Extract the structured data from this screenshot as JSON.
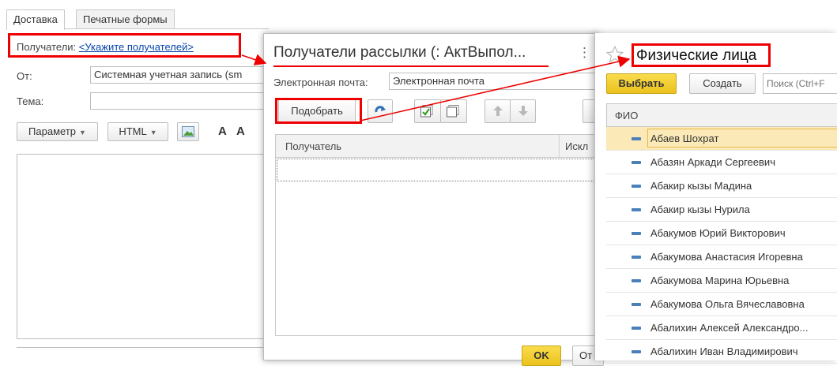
{
  "mail_form": {
    "tabs": [
      "Доставка",
      "Печатные формы"
    ],
    "recipients_label": "Получатели:",
    "recipients_link": "<Укажите получателей>",
    "from_label": "От:",
    "from_value": "Системная учетная запись (sm",
    "subject_label": "Тема:",
    "toolbar": {
      "param_button": "Параметр",
      "html_button": "HTML",
      "bold_a": "A",
      "italic_a": "A"
    }
  },
  "recipients_dialog": {
    "title": "Получатели рассылки (: АктВыпол...",
    "more_icon": "⋮",
    "email_label": "Электронная почта:",
    "email_value": "Электронная почта",
    "pick_button": "Подобрать",
    "columns": [
      "Получатель",
      "Искл"
    ],
    "ok_button": "OK",
    "cancel_button_partial": "От"
  },
  "persons_window": {
    "title": "Физические лица",
    "select_button": "Выбрать",
    "create_button": "Создать",
    "search_placeholder": "Поиск (Ctrl+F",
    "column": "ФИО",
    "rows": [
      "Абаев Шохрат",
      "Абазян Аркади Сергеевич",
      "Абакир кызы Мадина",
      "Абакир кызы Нурила",
      "Абакумов Юрий Викторович",
      "Абакумова Анастасия Игоревна",
      "Абакумова Марина Юрьевна",
      "Абакумова Ольга Вячеславовна",
      "Абалихин Алексей Александро...",
      "Абалихин Иван Владимирович"
    ],
    "selected_index": 0
  },
  "colors": {
    "highlight_red": "#e00000",
    "select_button_yellow": "#f5d33c",
    "selected_row": "#fbeab7",
    "link_blue": "#0645ad",
    "accent_blue": "#2c6fb7"
  },
  "icons": [
    "star-icon",
    "refresh-icon",
    "check-all-icon",
    "uncheck-all-icon",
    "move-up-icon",
    "move-down-icon",
    "image-icon",
    "row-dash-icon"
  ]
}
